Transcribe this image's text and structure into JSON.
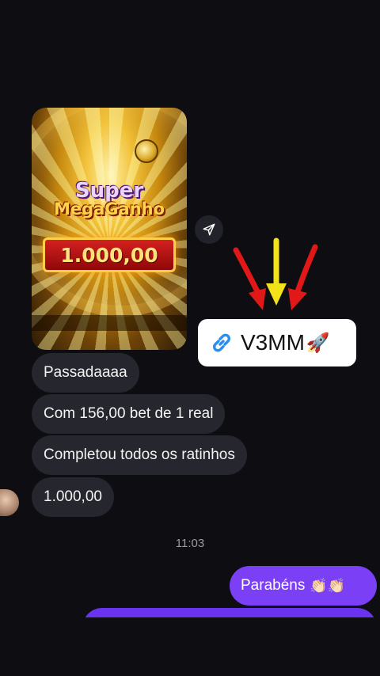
{
  "media": {
    "title_line1": "Super",
    "title_line2": "MegaGanho",
    "amount": "1.000,00"
  },
  "link_sticker": {
    "text": "V3MM",
    "emoji": "🚀",
    "icon": "link-icon"
  },
  "arrows": {
    "colors": [
      "#e01818",
      "#f2e21a",
      "#e01818"
    ]
  },
  "messages": [
    {
      "text": "Passadaaaa"
    },
    {
      "text": "Com 156,00 bet de 1 real"
    },
    {
      "text": "Completou todos os ratinhos"
    },
    {
      "text": "1.000,00"
    }
  ],
  "timestamp": "11:03",
  "sent_message": {
    "text": "Parabéns",
    "emoji": "👏🏻👏🏻"
  },
  "colors": {
    "background": "#0d0d12",
    "received_bubble": "#26262e",
    "sent_bubble": "#7b3ff5"
  }
}
